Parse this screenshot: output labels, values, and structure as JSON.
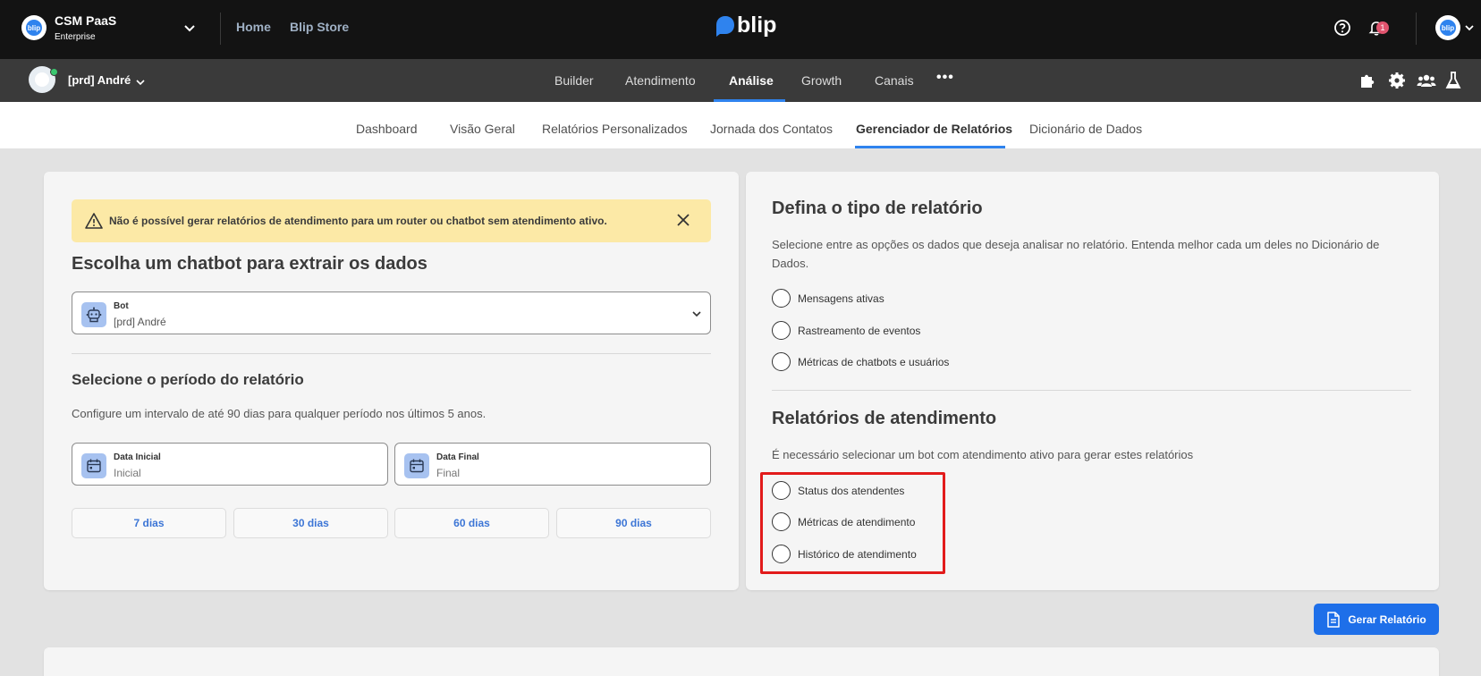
{
  "topbar": {
    "org_name": "CSM PaaS",
    "org_plan": "Enterprise",
    "org_logo_text": "blip",
    "links": [
      "Home",
      "Blip Store"
    ],
    "brand": "blip",
    "notifications_count": "1",
    "user_avatar_text": "blip"
  },
  "subbar": {
    "bot_name": "[prd] André",
    "modules": [
      "Builder",
      "Atendimento",
      "Análise",
      "Growth",
      "Canais"
    ],
    "active_module": "Análise",
    "more_label": "•••"
  },
  "analysis_tabs": {
    "items": [
      "Dashboard",
      "Visão Geral",
      "Relatórios Personalizados",
      "Jornada dos Contatos",
      "Gerenciador de Relatórios",
      "Dicionário de Dados"
    ],
    "active": "Gerenciador de Relatórios"
  },
  "left": {
    "warning": "Não é possível gerar relatórios de atendimento para um router ou chatbot sem atendimento ativo.",
    "title": "Escolha um chatbot para extrair os dados",
    "bot_field_label": "Bot",
    "bot_field_value": "[prd] André",
    "period_title": "Selecione o período do relatório",
    "period_desc": "Configure um intervalo de até 90 dias para qualquer período nos últimos 5 anos.",
    "start_label": "Data Inicial",
    "start_placeholder": "Inicial",
    "end_label": "Data Final",
    "end_placeholder": "Final",
    "quick_ranges": [
      "7 dias",
      "30 dias",
      "60 dias",
      "90 dias"
    ]
  },
  "right": {
    "title": "Defina o tipo de relatório",
    "desc": "Selecione entre as opções os dados que deseja analisar no relatório. Entenda melhor cada um deles no Dicionário de Dados.",
    "options": [
      "Mensagens ativas",
      "Rastreamento de eventos",
      "Métricas de chatbots e usuários"
    ],
    "attendance_title": "Relatórios de atendimento",
    "attendance_desc": "É necessário selecionar um bot com atendimento ativo para gerar estes relatórios",
    "attendance_options": [
      "Status dos atendentes",
      "Métricas de atendimento",
      "Histórico de atendimento"
    ]
  },
  "actions": {
    "generate": "Gerar Relatório"
  },
  "colors": {
    "accent": "#1e6fe9",
    "warning_bg": "#fce9a6",
    "highlight": "#e21b1b"
  }
}
